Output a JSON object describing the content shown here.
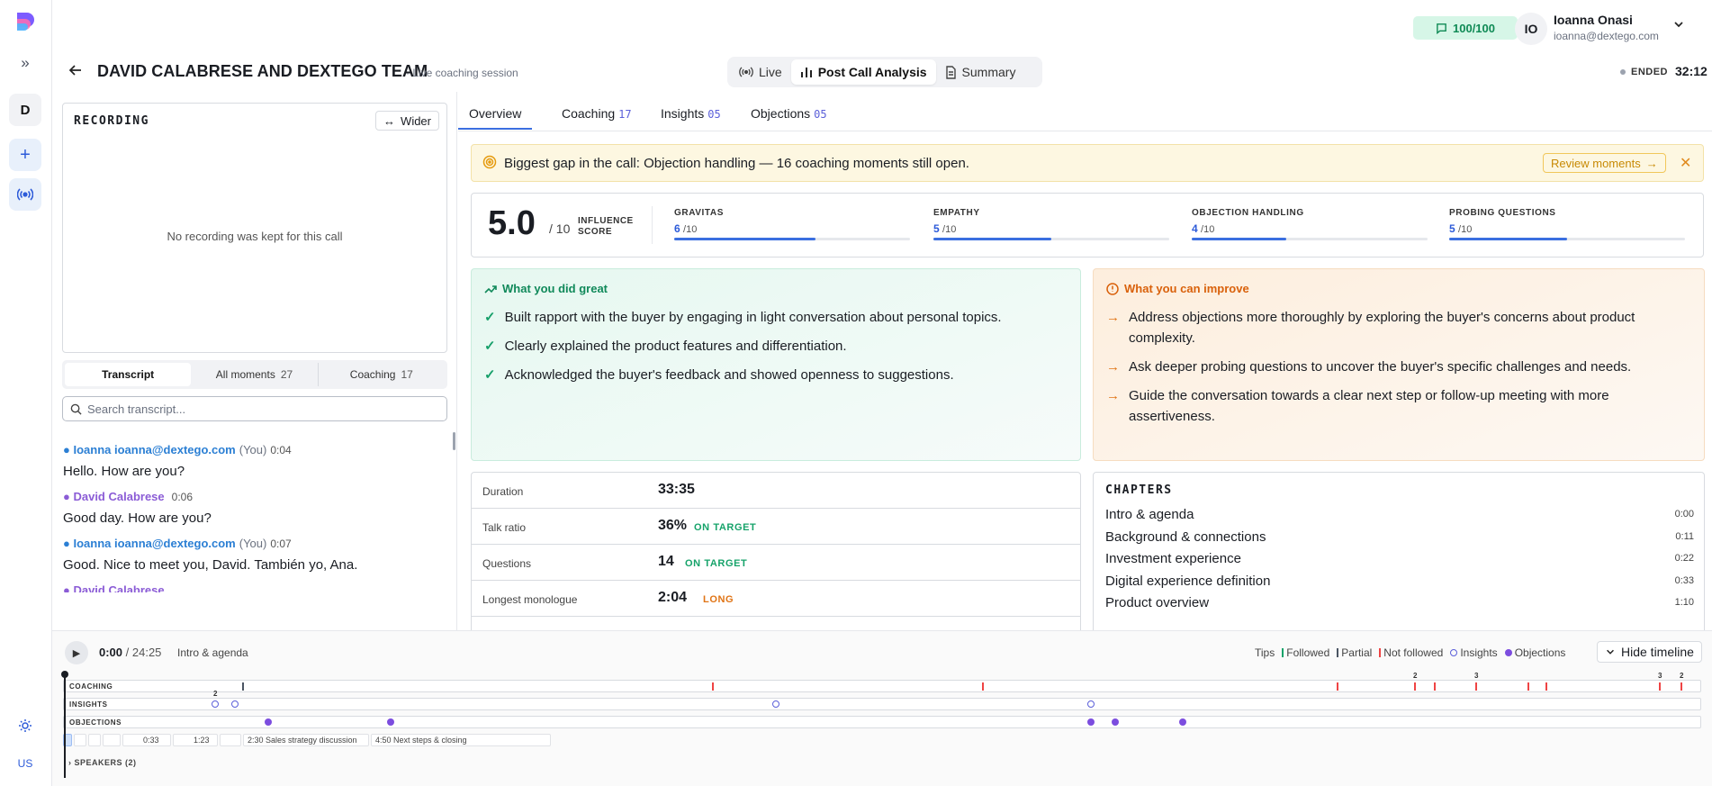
{
  "rail": {
    "workspace_initial": "D",
    "locale": "US"
  },
  "header": {
    "credits": "100/100",
    "user_initials": "IO",
    "user_name": "Ioanna Onasi",
    "user_email": "ioanna@dextego.com"
  },
  "session": {
    "title": "DAVID CALABRESE AND DEXTEGO TEAM",
    "subtitle": "· Live coaching session",
    "modes": [
      "Live",
      "Post Call Analysis",
      "Summary"
    ],
    "status": "ENDED",
    "elapsed": "32:12"
  },
  "recording": {
    "title": "RECORDING",
    "wider_label": "Wider",
    "empty_text": "No recording was kept for this call"
  },
  "transcript_tabs": [
    {
      "label": "Transcript",
      "count": ""
    },
    {
      "label": "All moments",
      "count": "27"
    },
    {
      "label": "Coaching",
      "count": "17"
    }
  ],
  "transcript": {
    "search_placeholder": "Search transcript...",
    "messages": [
      {
        "speaker": "Ioanna ioanna@dextego.com",
        "you": "(You)",
        "time": "0:04",
        "text": "Hello. How are you?",
        "color": "#2b7fd4"
      },
      {
        "speaker": "David Calabrese",
        "you": "",
        "time": "0:06",
        "text": "Good day. How are you?",
        "color": "#8b5cd6"
      },
      {
        "speaker": "Ioanna ioanna@dextego.com",
        "you": "(You)",
        "time": "0:07",
        "text": "Good. Nice to meet you, David. También yo, Ana.",
        "color": "#2b7fd4"
      }
    ]
  },
  "analysis_tabs": [
    {
      "label": "Overview",
      "count": ""
    },
    {
      "label": "Coaching",
      "count": "17"
    },
    {
      "label": "Insights",
      "count": "05"
    },
    {
      "label": "Objections",
      "count": "05"
    }
  ],
  "banner": {
    "text": "Biggest gap in the call: Objection handling — 16 coaching moments still open.",
    "action": "Review moments"
  },
  "scores": {
    "influence": "5.0",
    "max": "/ 10",
    "label_line1": "INFLUENCE",
    "label_line2": "SCORE",
    "metrics": [
      {
        "name": "GRAVITAS",
        "value": "6",
        "max": "/10",
        "fraction": 0.6
      },
      {
        "name": "EMPATHY",
        "value": "5",
        "max": "/10",
        "fraction": 0.5
      },
      {
        "name": "OBJECTION HANDLING",
        "value": "4",
        "max": "/10",
        "fraction": 0.4
      },
      {
        "name": "PROBING QUESTIONS",
        "value": "5",
        "max": "/10",
        "fraction": 0.5
      }
    ]
  },
  "great": {
    "title": "What you did great",
    "items": [
      "Built rapport with the buyer by engaging in light conversation about personal topics.",
      "Clearly explained the product features and differentiation.",
      "Acknowledged the buyer's feedback and showed openness to suggestions."
    ]
  },
  "improve": {
    "title": "What you can improve",
    "items": [
      "Address objections more thoroughly by exploring the buyer's concerns about product complexity.",
      "Ask deeper probing questions to uncover the buyer's specific challenges and needs.",
      "Guide the conversation towards a clear next step or follow-up meeting with more assertiveness."
    ]
  },
  "stats": [
    {
      "label": "Duration",
      "value": "33:35",
      "badge": "",
      "badge_color": ""
    },
    {
      "label": "Talk ratio",
      "value": "36%",
      "badge": "ON TARGET",
      "badge_color": "#16a36a"
    },
    {
      "label": "Questions",
      "value": "14",
      "badge": "ON TARGET",
      "badge_color": "#16a36a"
    },
    {
      "label": "Longest monologue",
      "value": "2:04",
      "badge": "LONG",
      "badge_color": "#e07415"
    }
  ],
  "chapters": {
    "title": "CHAPTERS",
    "items": [
      {
        "name": "Intro & agenda",
        "time": "0:00"
      },
      {
        "name": "Background & connections",
        "time": "0:11"
      },
      {
        "name": "Investment experience",
        "time": "0:22"
      },
      {
        "name": "Digital experience definition",
        "time": "0:33"
      },
      {
        "name": "Product overview",
        "time": "1:10"
      }
    ]
  },
  "timeline": {
    "current": "0:00",
    "total": "/ 24:25",
    "chapter": "Intro & agenda",
    "legend": {
      "tips": "Tips",
      "followed": "Followed",
      "partial": "Partial",
      "not_followed": "Not followed",
      "insights": "Insights",
      "objections": "Objections"
    },
    "hide_label": "Hide timeline",
    "lane_coaching": "COACHING",
    "lane_insights": "INSIGHTS",
    "lane_objections": "OBJECTIONS",
    "speakers_label": "SPEAKERS (2)",
    "chapter_segments": [
      {
        "label": ""
      },
      {
        "label": ""
      },
      {
        "label": ""
      },
      {
        "label": ""
      },
      {
        "label": "0:33"
      },
      {
        "label": "1:23"
      },
      {
        "label": ""
      },
      {
        "label": "2:30  Sales strategy discussion"
      },
      {
        "label": "4:50  Next steps & closing"
      }
    ]
  }
}
